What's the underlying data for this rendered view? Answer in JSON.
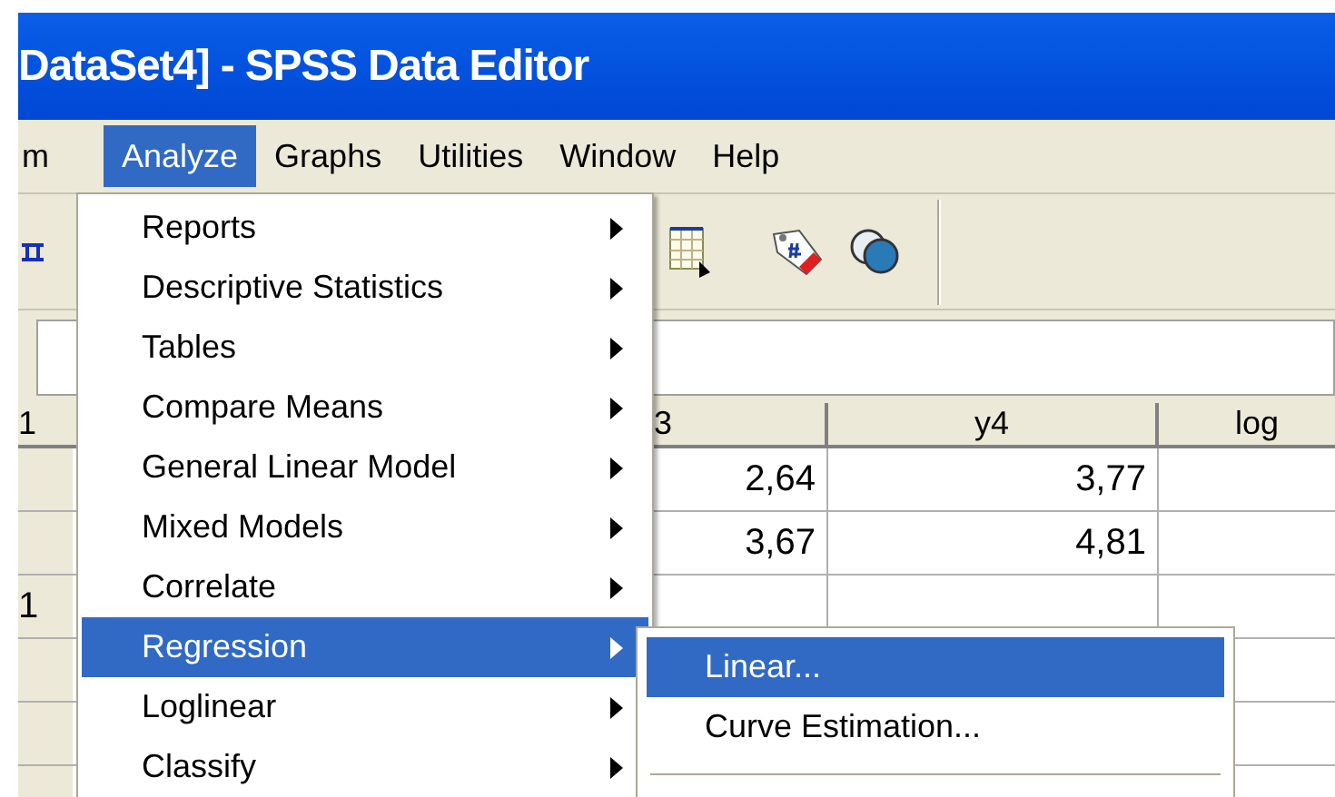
{
  "window": {
    "title": "DataSet4] - SPSS Data Editor"
  },
  "menu_bar": [
    {
      "label": "m",
      "selected": false
    },
    {
      "label": "Analyze",
      "selected": true
    },
    {
      "label": "Graphs",
      "selected": false
    },
    {
      "label": "Utilities",
      "selected": false
    },
    {
      "label": "Window",
      "selected": false
    },
    {
      "label": "Help",
      "selected": false
    }
  ],
  "analyze_menu": [
    {
      "label": "Reports",
      "has_submenu": true,
      "selected": false
    },
    {
      "label": "Descriptive Statistics",
      "has_submenu": true,
      "selected": false
    },
    {
      "label": "Tables",
      "has_submenu": true,
      "selected": false
    },
    {
      "label": "Compare Means",
      "has_submenu": true,
      "selected": false
    },
    {
      "label": "General Linear Model",
      "has_submenu": true,
      "selected": false
    },
    {
      "label": "Mixed Models",
      "has_submenu": true,
      "selected": false
    },
    {
      "label": "Correlate",
      "has_submenu": true,
      "selected": false
    },
    {
      "label": "Regression",
      "has_submenu": true,
      "selected": true
    },
    {
      "label": "Loglinear",
      "has_submenu": true,
      "selected": false
    },
    {
      "label": "Classify",
      "has_submenu": true,
      "selected": false
    }
  ],
  "regression_submenu": [
    {
      "label": "Linear...",
      "selected": true
    },
    {
      "label": "Curve Estimation...",
      "selected": false
    }
  ],
  "table": {
    "columns": [
      "1",
      "3",
      "y4",
      "log"
    ],
    "rows": [
      {
        "cells": [
          "2,64",
          "3,77"
        ]
      },
      {
        "cells": [
          "3,67",
          "4,81"
        ]
      },
      {
        "number": "1"
      },
      {},
      {},
      {}
    ]
  }
}
